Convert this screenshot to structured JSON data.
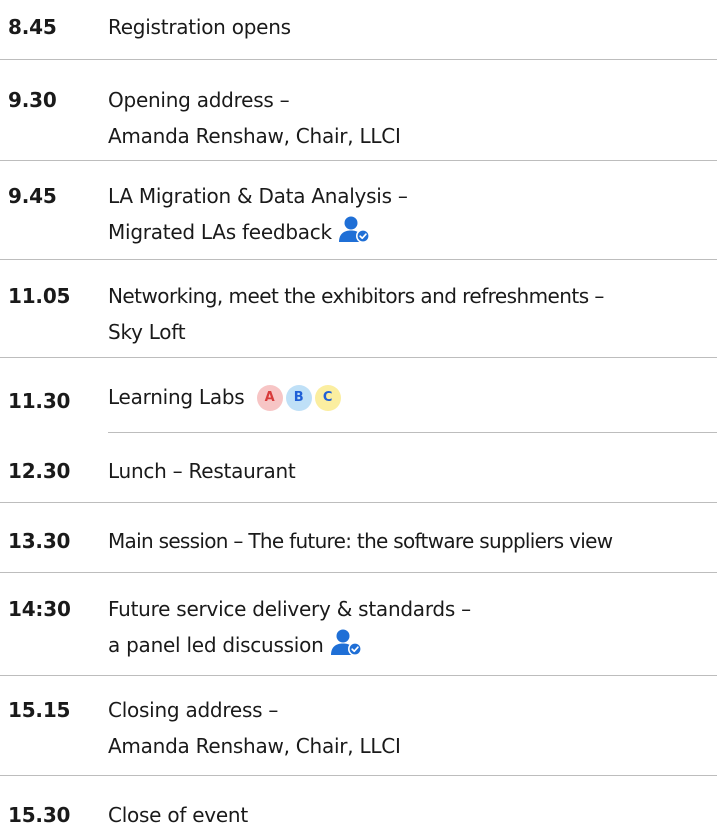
{
  "colors": {
    "icon_blue": "#1f6fd6",
    "divider": "#bdbdbd",
    "badge_a_bg": "#f7c5c5",
    "badge_b_bg": "#bfe0f7",
    "badge_c_bg": "#fbeea0"
  },
  "agenda": [
    {
      "time": "8.45",
      "lines": [
        "Registration opens"
      ]
    },
    {
      "time": "9.30",
      "lines": [
        "Opening address –",
        "Amanda Renshaw, Chair, LLCI"
      ]
    },
    {
      "time": "9.45",
      "lines": [
        "LA Migration & Data Analysis –",
        "Migrated LAs feedback"
      ],
      "icon": "person-verified-icon"
    },
    {
      "time": "11.05",
      "lines": [
        "Networking, meet the exhibitors and refreshments –",
        "Sky Loft"
      ]
    },
    {
      "time": "11.30",
      "lines": [
        "Learning Labs"
      ],
      "badges": [
        "A",
        "B",
        "C"
      ]
    },
    {
      "time": "12.30",
      "lines": [
        "Lunch – Restaurant"
      ]
    },
    {
      "time": "13.30",
      "lines": [
        "Main session – The future: the software suppliers view"
      ]
    },
    {
      "time": "14:30",
      "lines": [
        "Future service delivery & standards –",
        "a panel led discussion"
      ],
      "icon": "person-verified-icon"
    },
    {
      "time": "15.15",
      "lines": [
        "Closing address –",
        "Amanda Renshaw, Chair, LLCI"
      ]
    },
    {
      "time": "15.30",
      "lines": [
        "Close of event"
      ]
    }
  ]
}
